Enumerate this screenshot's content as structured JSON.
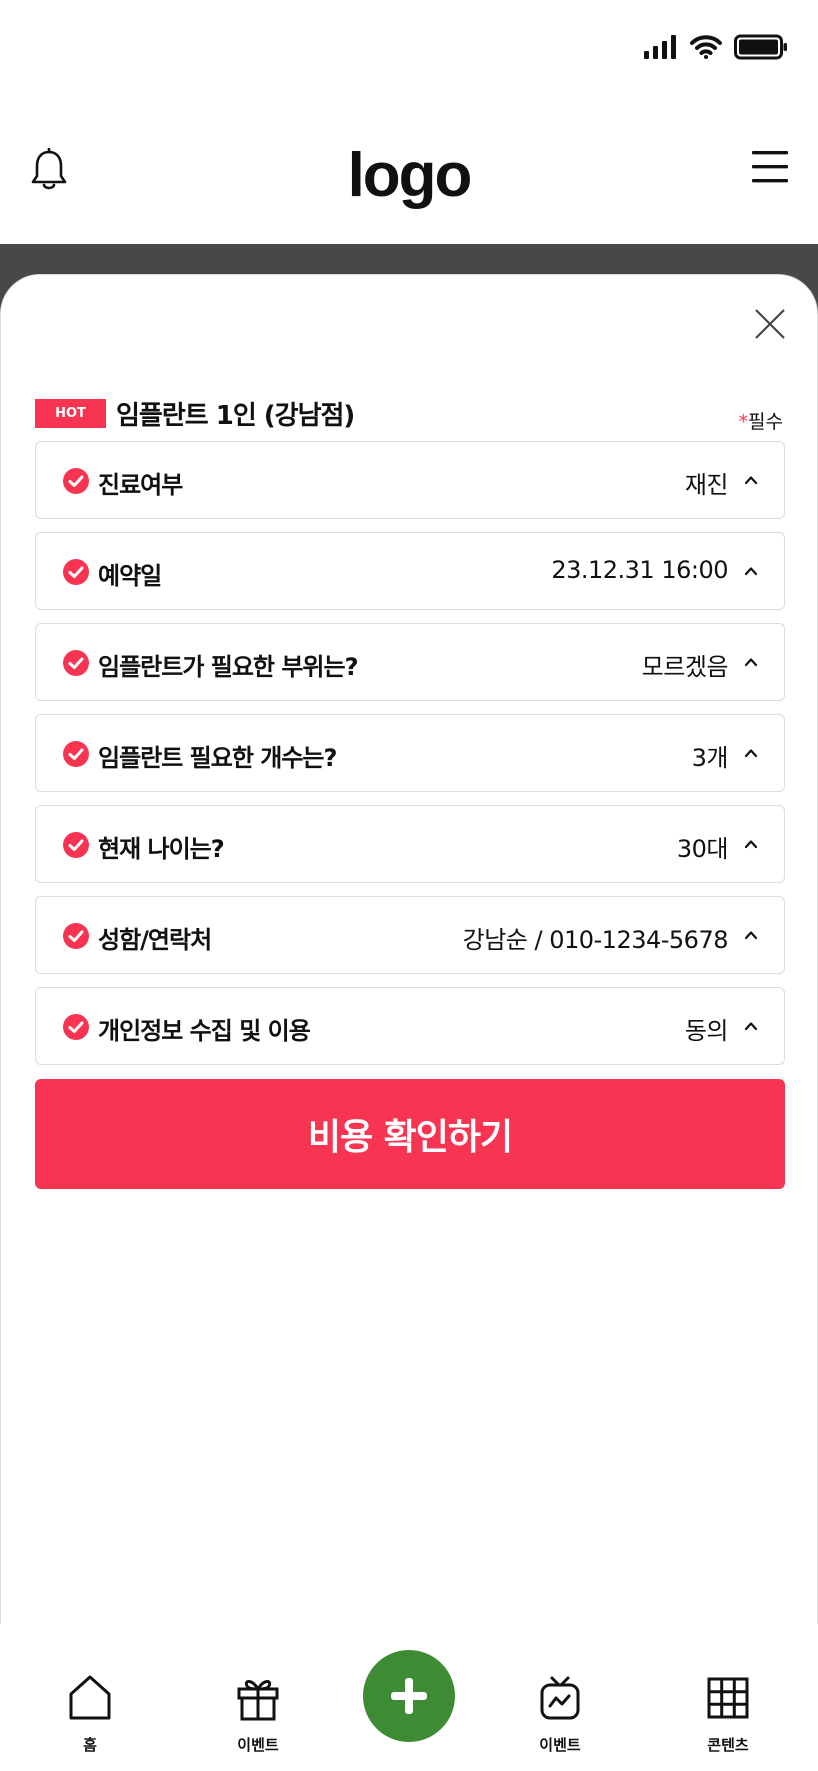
{
  "header": {
    "logo": "logo"
  },
  "modal": {
    "badge": "HOT",
    "title": "임플란트 1인 (강남점)",
    "required_star": "*",
    "required_label": "필수",
    "rows": [
      {
        "label": "진료여부",
        "value": "재진"
      },
      {
        "label": "예약일",
        "value": "23.12.31 16:00"
      },
      {
        "label": "임플란트가 필요한 부위는?",
        "value": "모르겠음"
      },
      {
        "label": "임플란트 필요한 개수는?",
        "value": "3개"
      },
      {
        "label": "현재 나이는?",
        "value": "30대"
      },
      {
        "label": "성함/연락처",
        "value": "강남순 / 010-1234-5678"
      },
      {
        "label": "개인정보 수집 및 이용",
        "value": "동의"
      }
    ],
    "cta_label": "비용 확인하기"
  },
  "tabbar": {
    "home": "홈",
    "event1": "이벤트",
    "event2": "이벤트",
    "contents": "콘텐츠"
  },
  "colors": {
    "accent": "#f73452",
    "fab": "#3d8b33",
    "backdrop": "#484848"
  }
}
